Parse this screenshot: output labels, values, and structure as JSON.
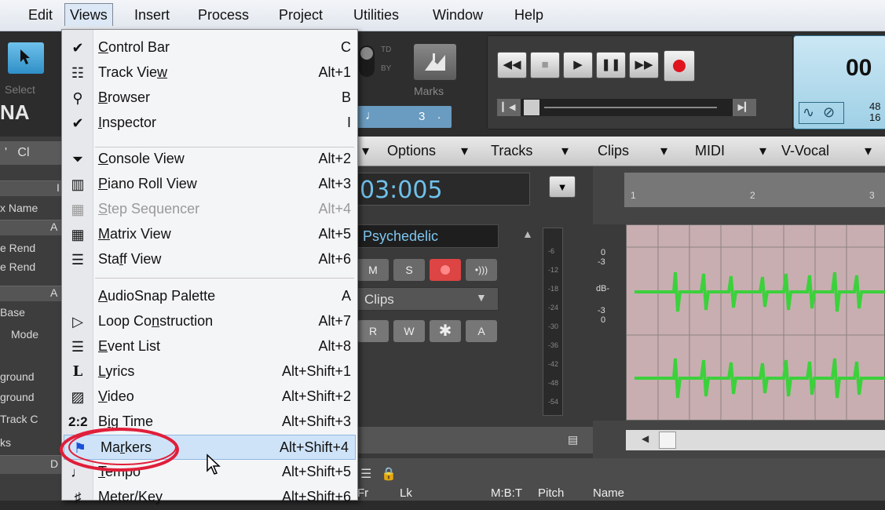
{
  "menubar": {
    "items": [
      {
        "label": "Edit"
      },
      {
        "label": "Views"
      },
      {
        "label": "Insert"
      },
      {
        "label": "Process"
      },
      {
        "label": "Project"
      },
      {
        "label": "Utilities"
      },
      {
        "label": "Window"
      },
      {
        "label": "Help"
      }
    ]
  },
  "left_panel": {
    "select_label": "Select",
    "logo_fragment": "NA",
    "rows": [
      "x Name",
      "e Rend",
      "e Rend",
      "Base",
      "Mode",
      "ground",
      "ground",
      "Track C",
      "ks"
    ],
    "header_letters": [
      "I",
      "A",
      "A",
      "D"
    ]
  },
  "views_menu": {
    "items": [
      {
        "pre": "",
        "ul": "C",
        "post": "ontrol Bar",
        "shortcut": "C",
        "icon": "check-icon",
        "disabled": false
      },
      {
        "pre": "Track Vie",
        "ul": "w",
        "post": "",
        "shortcut": "Alt+1",
        "icon": "track-view-icon",
        "disabled": false
      },
      {
        "pre": "",
        "ul": "B",
        "post": "rowser",
        "shortcut": "B",
        "icon": "browser-icon",
        "disabled": false
      },
      {
        "pre": "",
        "ul": "I",
        "post": "nspector",
        "shortcut": "I",
        "icon": "check-icon",
        "disabled": false
      },
      {
        "pre": "",
        "ul": "C",
        "post": "onsole View",
        "shortcut": "Alt+2",
        "icon": "console-icon",
        "disabled": false
      },
      {
        "pre": "",
        "ul": "P",
        "post": "iano Roll View",
        "shortcut": "Alt+3",
        "icon": "piano-roll-icon",
        "disabled": false
      },
      {
        "pre": "",
        "ul": "S",
        "post": "tep Sequencer",
        "shortcut": "Alt+4",
        "icon": "step-sequencer-icon",
        "disabled": true
      },
      {
        "pre": "",
        "ul": "M",
        "post": "atrix View",
        "shortcut": "Alt+5",
        "icon": "matrix-icon",
        "disabled": false
      },
      {
        "pre": "Sta",
        "ul": "f",
        "post": "f View",
        "shortcut": "Alt+6",
        "icon": "staff-icon",
        "disabled": false
      },
      {
        "pre": "",
        "ul": "A",
        "post": "udioSnap Palette",
        "shortcut": "A",
        "icon": "",
        "disabled": false
      },
      {
        "pre": "Loop Co",
        "ul": "n",
        "post": "struction",
        "shortcut": "Alt+7",
        "icon": "loop-icon",
        "disabled": false
      },
      {
        "pre": "",
        "ul": "E",
        "post": "vent List",
        "shortcut": "Alt+8",
        "icon": "event-list-icon",
        "disabled": false
      },
      {
        "pre": "",
        "ul": "L",
        "post": "yrics",
        "shortcut": "Alt+Shift+1",
        "icon": "lyrics-icon",
        "disabled": false
      },
      {
        "pre": "",
        "ul": "V",
        "post": "ideo",
        "shortcut": "Alt+Shift+2",
        "icon": "video-icon",
        "disabled": false
      },
      {
        "pre": "B",
        "ul": "i",
        "post": "g Time",
        "shortcut": "Alt+Shift+3",
        "icon": "big-time-icon",
        "disabled": false
      },
      {
        "pre": "Ma",
        "ul": "r",
        "post": "kers",
        "shortcut": "Alt+Shift+4",
        "icon": "markers-icon",
        "disabled": false
      },
      {
        "pre": "",
        "ul": "T",
        "post": "empo",
        "shortcut": "Alt+Shift+5",
        "icon": "tempo-icon",
        "disabled": false
      },
      {
        "pre": "Meter/Key",
        "ul": "",
        "post": "",
        "shortcut": "Alt+Shift+6",
        "icon": "meter-key-icon",
        "disabled": false
      }
    ]
  },
  "toolbar": {
    "td_label": "TD",
    "by_label": "BY",
    "marks_label": "Marks",
    "snap_value": "3",
    "time_display": "00",
    "lcd_small_top": "48",
    "lcd_small_bottom": "16"
  },
  "track_toolbar": {
    "items": [
      "Options",
      "Tracks",
      "Clips",
      "MIDI",
      "V-Vocal"
    ]
  },
  "track": {
    "time_value": "03:005",
    "ruler_marks": [
      "1",
      "2",
      "3"
    ],
    "name": "Psychedelic",
    "buttons": {
      "mute": "M",
      "solo": "S",
      "read": "R",
      "write": "W",
      "auto": "A"
    },
    "clips_label": "Clips",
    "meter_labels": [
      "-6",
      "-12",
      "-18",
      "-24",
      "-30",
      "-36",
      "-42",
      "-48",
      "-54"
    ],
    "db_labels": [
      "0",
      "-3",
      "dB-",
      "-3",
      "0"
    ]
  },
  "bottom_bar": {
    "cols": [
      "Fr",
      "Lk",
      "M:B:T",
      "Pitch",
      "Name"
    ]
  },
  "colors": {
    "waveform": "#3cd13c",
    "clip_bg": "#c8aeb0",
    "highlight": "#cfe3f8",
    "annotation": "#e01f3a"
  }
}
